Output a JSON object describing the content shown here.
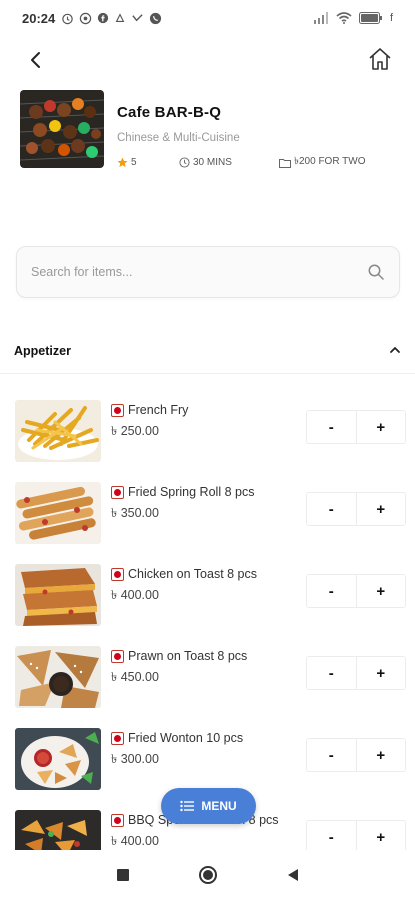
{
  "status_bar": {
    "time": "20:24",
    "battery_label": "f"
  },
  "nav": {
    "back_icon": "chevron-left-icon",
    "home_icon": "home-icon"
  },
  "restaurant": {
    "name": "Cafe BAR-B-Q",
    "cuisine": "Chinese & Multi-Cuisine",
    "rating": "5",
    "delivery_time": "30 MINS",
    "cost_for_two": "৳200 FOR TWO",
    "rating_color": "#f39c12"
  },
  "search": {
    "placeholder": "Search for items..."
  },
  "section": {
    "title": "Appetizer"
  },
  "menu_items": [
    {
      "name": "French Fry",
      "price": "৳ 250.00",
      "minus": "-",
      "plus": "+"
    },
    {
      "name": "Fried Spring Roll 8 pcs",
      "price": "৳ 350.00",
      "minus": "-",
      "plus": "+"
    },
    {
      "name": "Chicken on Toast 8 pcs",
      "price": "৳ 400.00",
      "minus": "-",
      "plus": "+"
    },
    {
      "name": "Prawn on Toast 8 pcs",
      "price": "৳ 450.00",
      "minus": "-",
      "plus": "+"
    },
    {
      "name": "Fried Wonton 10 pcs",
      "price": "৳ 300.00",
      "minus": "-",
      "plus": "+"
    },
    {
      "name": "BBQ Special Wonton 8 pcs",
      "price": "৳ 400.00",
      "minus": "-",
      "plus": "+"
    }
  ],
  "fab": {
    "label": "MENU",
    "color": "#4a7fd8"
  },
  "colors": {
    "accent": "#4a7fd8",
    "non_veg_dot": "#d0021b"
  }
}
